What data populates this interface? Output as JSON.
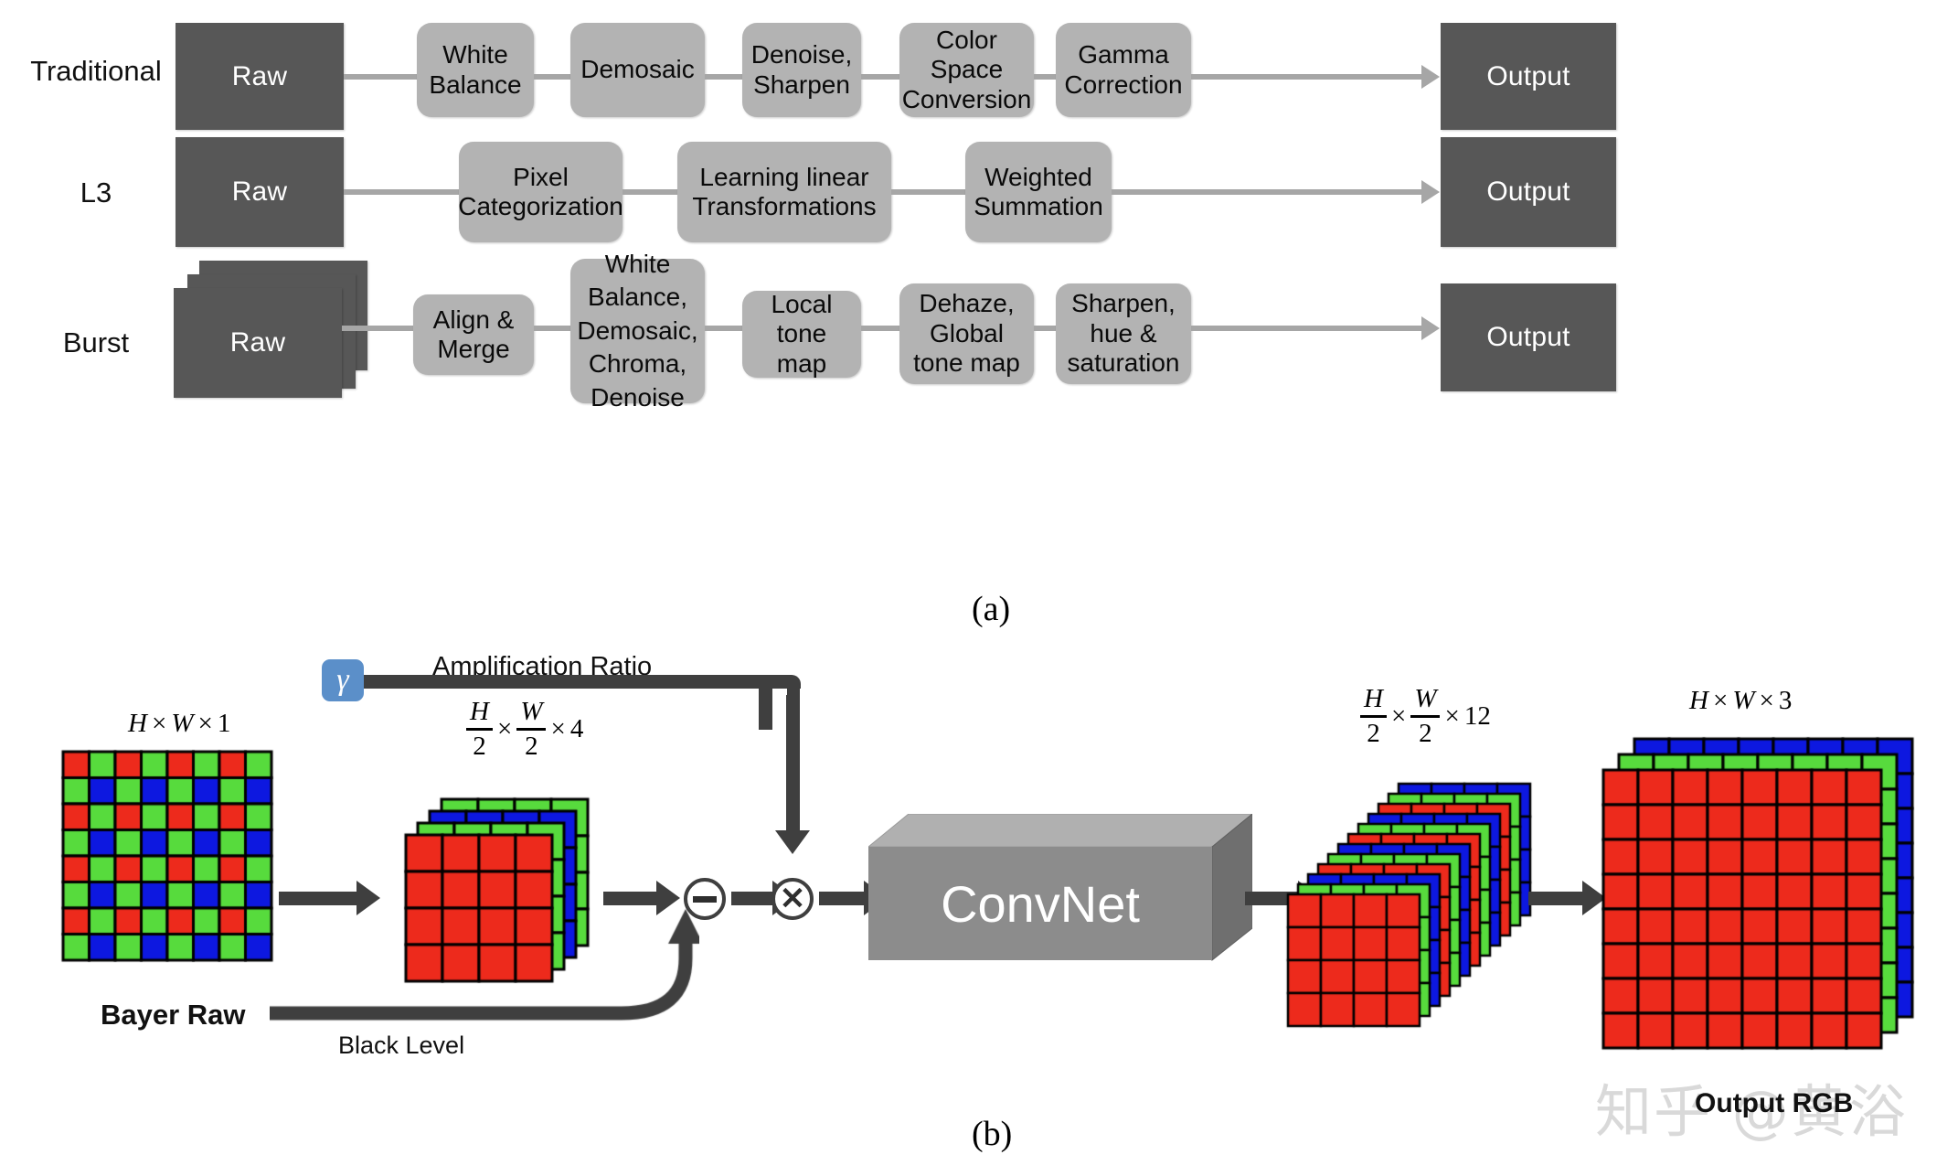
{
  "figure": {
    "panel_a_caption": "(a)",
    "panel_b_caption": "(b)"
  },
  "pipelines": [
    {
      "name": "Traditional",
      "label": "Traditional",
      "input": "Raw",
      "output": "Output",
      "stages": [
        "White Balance",
        "Demosaic",
        "Denoise, Sharpen",
        "Color Space Conversion",
        "Gamma Correction"
      ]
    },
    {
      "name": "L3",
      "label": "L3",
      "input": "Raw",
      "output": "Output",
      "stages": [
        "Pixel Categorization",
        "Learning linear Transformations",
        "Weighted Summation"
      ]
    },
    {
      "name": "Burst",
      "label": "Burst",
      "input": "Raw",
      "output": "Output",
      "stages": [
        "Align & Merge",
        "White Balance, Demosaic, Chroma, Denoise",
        "Local tone map",
        "Dehaze, Global tone map",
        "Sharpen, hue & saturation"
      ]
    }
  ],
  "network": {
    "gamma_symbol": "γ",
    "amplification_label": "Amplification Ratio",
    "black_level_label": "Black Level",
    "subtract_symbol": "−",
    "multiply_symbol": "✕",
    "convnet_label": "ConvNet",
    "input_label": "Bayer Raw",
    "output_label": "Output RGB",
    "dims": {
      "input": {
        "h": "H",
        "w": "W",
        "c": "1"
      },
      "packed": {
        "h": "H",
        "hden": "2",
        "w": "W",
        "wden": "2",
        "c": "4"
      },
      "features": {
        "h": "H",
        "hden": "2",
        "w": "W",
        "wden": "2",
        "c": "12"
      },
      "output": {
        "h": "H",
        "w": "W",
        "c": "3"
      }
    },
    "times_symbol": "×"
  },
  "tensors": {
    "bayer": {
      "cols": 8,
      "rows": 8,
      "pattern": "RGGB"
    },
    "packed_stack": {
      "planes": [
        "R",
        "G",
        "B",
        "G"
      ],
      "cols": 4,
      "rows": 4
    },
    "feature_stack": {
      "planes": [
        "R",
        "G",
        "B",
        "R",
        "G",
        "B",
        "R",
        "G",
        "B",
        "R",
        "G",
        "B"
      ],
      "cols": 4,
      "rows": 4
    },
    "rgb_stack": {
      "planes": [
        "R",
        "G",
        "B"
      ],
      "cols": 8,
      "rows": 8
    }
  },
  "colors": {
    "red": "#ed2a1c",
    "green": "#57db3d",
    "blue": "#0d18e0",
    "dark_box": "#575757",
    "stage_box": "#b3b3b3",
    "connector": "#a6a6a6",
    "arrow_dark": "#3f3f3f",
    "gamma_chip": "#5b8fc9",
    "convnet": "#8c8c8c",
    "watermark": "#d9d9d9"
  },
  "watermark": {
    "text": "知乎 @黄浴"
  }
}
